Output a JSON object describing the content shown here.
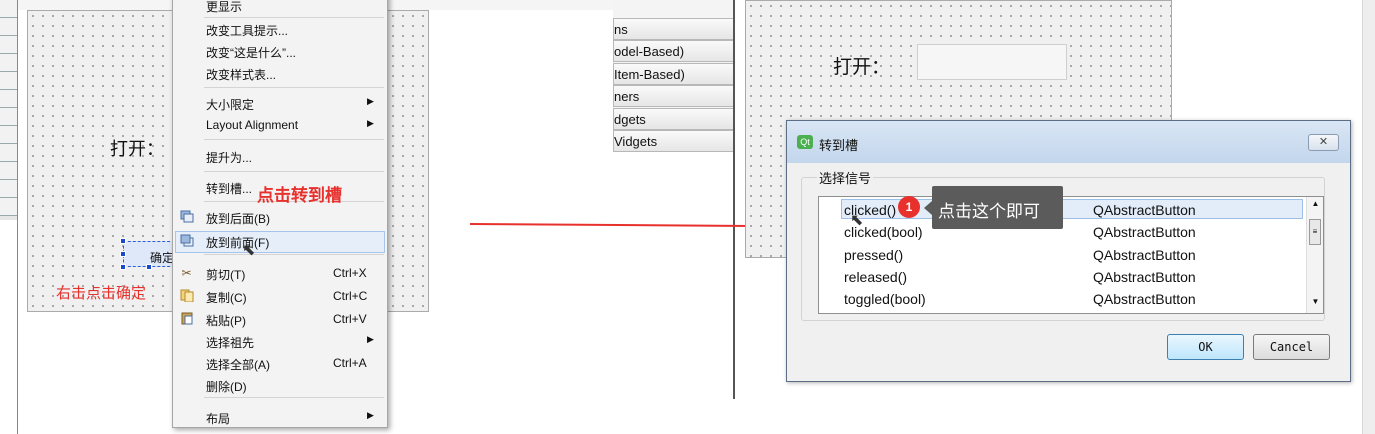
{
  "left": {
    "open_label": "打开：",
    "ok_button": "确定",
    "annotation": "右击点击确定"
  },
  "context_menu": {
    "partial_top": "更显示",
    "items": [
      {
        "label": "改变工具提示..."
      },
      {
        "label": "改变“这是什么”..."
      },
      {
        "label": "改变样式表..."
      },
      {
        "label": "大小限定",
        "submenu": true
      },
      {
        "label": "Layout Alignment",
        "submenu": true
      },
      {
        "label": "提升为..."
      },
      {
        "label": "转到槽..."
      },
      {
        "label": "放到后面(B)",
        "icon": "send-to-back-icon"
      },
      {
        "label": "放到前面(F)",
        "icon": "bring-to-front-icon",
        "highlighted": true
      },
      {
        "label": "剪切(T)",
        "shortcut": "Ctrl+X",
        "icon": "cut-icon"
      },
      {
        "label": "复制(C)",
        "shortcut": "Ctrl+C",
        "icon": "copy-icon"
      },
      {
        "label": "粘贴(P)",
        "shortcut": "Ctrl+V",
        "icon": "paste-icon"
      },
      {
        "label": "选择祖先",
        "submenu": true
      },
      {
        "label": "选择全部(A)",
        "shortcut": "Ctrl+A"
      },
      {
        "label": "删除(D)"
      },
      {
        "label": "布局",
        "submenu": true
      }
    ],
    "annotation": "点击转到槽"
  },
  "widget_box": {
    "items": [
      "ns",
      "odel-Based)",
      "Item-Based)",
      "ners",
      "dgets",
      "Vidgets"
    ]
  },
  "right": {
    "open_label": "打开："
  },
  "dialog": {
    "title": "转到槽",
    "close_label": "✕",
    "group_title": "选择信号",
    "signals": [
      {
        "name": "clicked()",
        "class": "QAbstractButton",
        "selected": true
      },
      {
        "name": "clicked(bool)",
        "class": "QAbstractButton"
      },
      {
        "name": "pressed()",
        "class": "QAbstractButton"
      },
      {
        "name": "released()",
        "class": "QAbstractButton"
      },
      {
        "name": "toggled(bool)",
        "class": "QAbstractButton"
      }
    ],
    "ok_label": "OK",
    "cancel_label": "Cancel"
  },
  "tooltip": {
    "badge": "1",
    "text": "点击这个即可"
  },
  "colors": {
    "annotation_red": "#e8312d",
    "tooltip_bg": "#5b5b5b",
    "selection_blue": "#e2edf9"
  }
}
